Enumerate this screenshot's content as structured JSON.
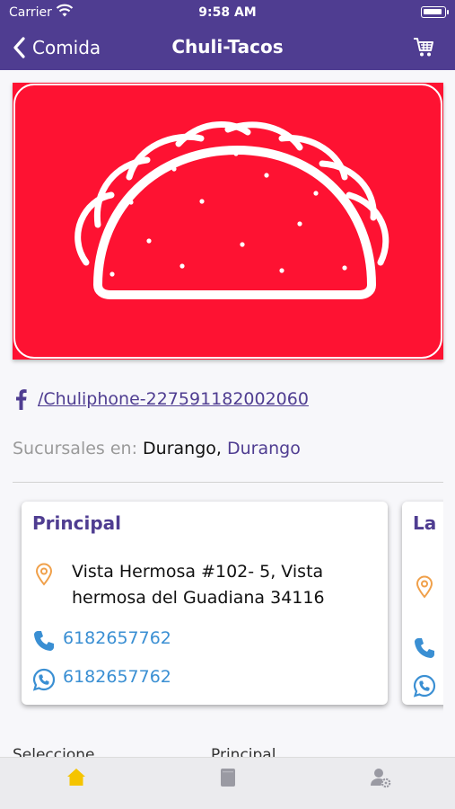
{
  "status_bar": {
    "carrier": "Carrier",
    "time": "9:58 AM"
  },
  "nav": {
    "back_label": "Comida",
    "title": "Chuli-Tacos"
  },
  "social": {
    "facebook_link": "/Chuliphone-227591182002060"
  },
  "branches": {
    "prefix": "Sucursales en:",
    "city": "Durango,",
    "state": "Durango"
  },
  "locations": [
    {
      "name": "Principal",
      "address": "Vista Hermosa #102- 5, Vista hermosa del Guadiana 34116",
      "phone": "6182657762",
      "whatsapp": "6182657762"
    },
    {
      "name": "La m"
    }
  ],
  "next_section": {
    "left_label": "Seleccione",
    "right_label": "Principal"
  },
  "tabs": [
    "home-icon",
    "menu-icon",
    "account-settings-icon"
  ],
  "colors": {
    "brand": "#4f3d91",
    "hero": "#fe1232",
    "accent_link": "#3a8fd3",
    "active_tab": "#f5c400",
    "map_pin": "#f0a04a"
  }
}
